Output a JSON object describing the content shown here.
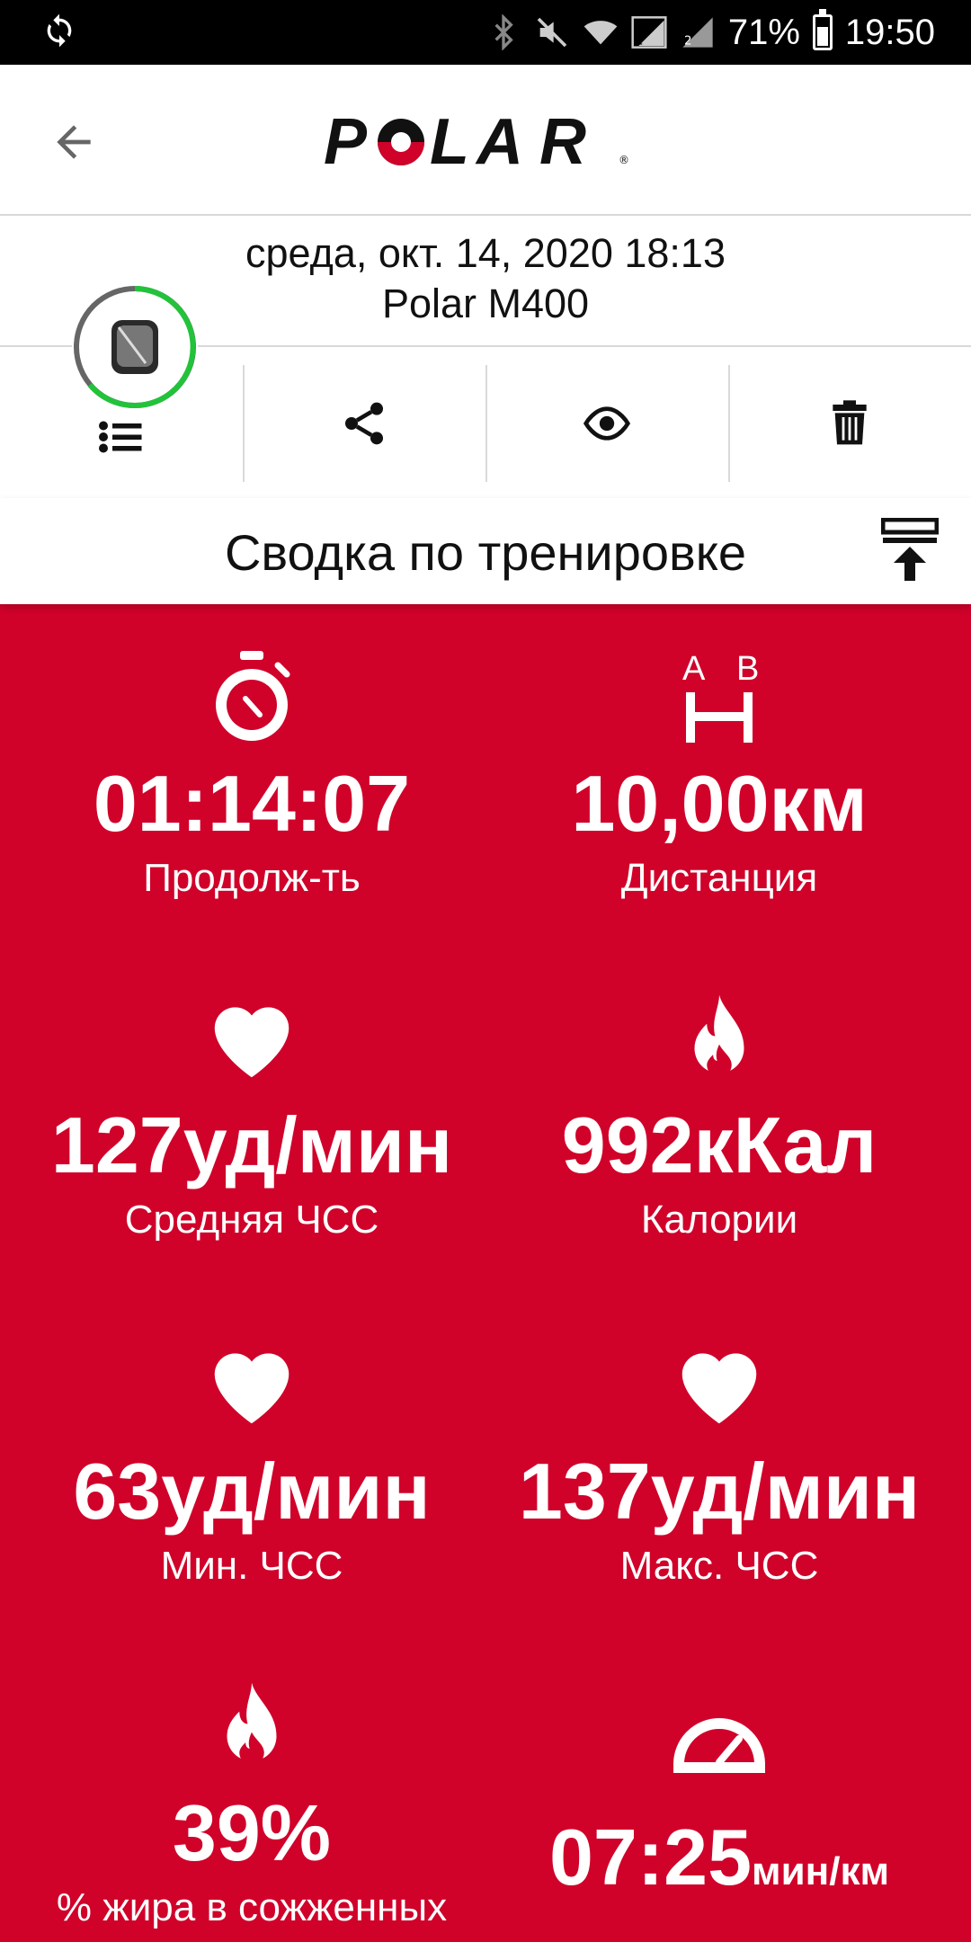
{
  "status_bar": {
    "battery": "71%",
    "time": "19:50",
    "battery_level": 0.71,
    "icons": [
      "sync-icon",
      "bluetooth-icon",
      "mute-icon",
      "wifi-icon",
      "signal-1-icon",
      "signal-2-icon"
    ]
  },
  "header": {
    "logo_text": "POLAR",
    "back_icon": "arrow-left-icon"
  },
  "session": {
    "date": "среда, окт. 14, 2020 18:13",
    "device": "Polar M400"
  },
  "actions": [
    {
      "name": "list",
      "icon": "list-icon"
    },
    {
      "name": "share",
      "icon": "share-icon"
    },
    {
      "name": "view",
      "icon": "eye-icon"
    },
    {
      "name": "delete",
      "icon": "trash-icon"
    }
  ],
  "section": {
    "title": "Сводка по тренировке",
    "export_icon": "export-icon"
  },
  "stats": [
    {
      "value": "01:14:07",
      "unit": "",
      "label": "Продолж-ть",
      "icon": "stopwatch-icon"
    },
    {
      "value": "10,00км",
      "unit": "",
      "label": "Дистанция",
      "icon": "distance-icon",
      "icon_letters": [
        "A",
        "B"
      ]
    },
    {
      "value": "127уд/мин",
      "unit": "",
      "label": "Средняя ЧСС",
      "icon": "heart-icon"
    },
    {
      "value": "992кКал",
      "unit": "",
      "label": "Калории",
      "icon": "flame-icon"
    },
    {
      "value": "63уд/мин",
      "unit": "",
      "label": "Мин. ЧСС",
      "icon": "heart-icon"
    },
    {
      "value": "137уд/мин",
      "unit": "",
      "label": "Макс. ЧСС",
      "icon": "heart-icon"
    },
    {
      "value": "39%",
      "unit": "",
      "label": "% жира в сожженных",
      "icon": "flame-icon"
    },
    {
      "value": "07:25",
      "unit": "мин/км",
      "label": "",
      "icon": "speedometer-icon"
    }
  ],
  "colors": {
    "brand_red": "#d0022a",
    "progress_ring": "#22c33a"
  }
}
